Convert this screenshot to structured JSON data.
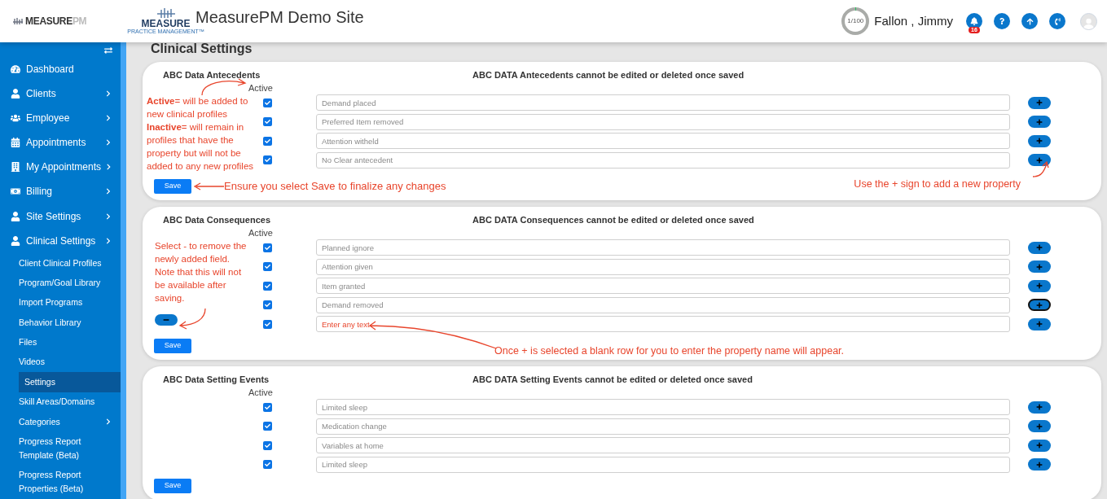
{
  "header": {
    "logo_text_a": "MEASURE",
    "logo_text_b": "PM",
    "brand_word": "MEASURE",
    "brand_tagline": "PRACTICE MANAGEMENT™",
    "site_title": "MeasurePM Demo Site",
    "progress": {
      "label": "1/100",
      "level": 0.01
    },
    "user_name": "Fallon , Jimmy",
    "notification_count": "16"
  },
  "sidebar": {
    "items": [
      {
        "label": "Dashboard",
        "kind": "gauge",
        "chevron": false
      },
      {
        "label": "Clients",
        "kind": "user",
        "chevron": true
      },
      {
        "label": "Employee",
        "kind": "users",
        "chevron": true
      },
      {
        "label": "Appointments",
        "kind": "calendar",
        "chevron": true
      },
      {
        "label": "My Appointments",
        "kind": "building",
        "chevron": true
      },
      {
        "label": "Billing",
        "kind": "money",
        "chevron": true
      },
      {
        "label": "Site Settings",
        "kind": "user",
        "chevron": true
      },
      {
        "label": "Clinical Settings",
        "kind": "user",
        "chevron": true,
        "expanded": true,
        "children": [
          {
            "label": "Client Clinical Profiles",
            "selected": false,
            "chevron": false
          },
          {
            "label": "Program/Goal Library",
            "selected": false,
            "chevron": false
          },
          {
            "label": "Import Programs",
            "selected": false,
            "chevron": false
          },
          {
            "label": "Behavior Library",
            "selected": false,
            "chevron": false
          },
          {
            "label": "Files",
            "selected": false,
            "chevron": false
          },
          {
            "label": "Videos",
            "selected": false,
            "chevron": false
          },
          {
            "label": "Settings",
            "selected": true,
            "chevron": false
          },
          {
            "label": "Skill Areas/Domains",
            "selected": false,
            "chevron": false
          },
          {
            "label": "Categories",
            "selected": false,
            "chevron": true
          },
          {
            "label": "Progress Report Template (Beta)",
            "selected": false,
            "chevron": false
          },
          {
            "label": "Progress Report Properties (Beta)",
            "selected": false,
            "chevron": false
          }
        ]
      }
    ]
  },
  "page_title": "Clinical Settings",
  "sections": [
    {
      "title": "ABC Data Antecedents",
      "notice": "ABC DATA Antecedents cannot be edited or deleted once saved",
      "active_label": "Active",
      "notes": [
        "**Active**= will be added to new clinical profiles",
        "**Inactive**= will remain in profiles that have the property but will not be added to any new profiles"
      ],
      "remove_button": false,
      "rows": [
        {
          "checked": true,
          "value": "Demand placed",
          "focused": false
        },
        {
          "checked": true,
          "value": "Preferred Item removed",
          "focused": false
        },
        {
          "checked": true,
          "value": "Attention witheld",
          "focused": false
        },
        {
          "checked": true,
          "value": "No Clear antecedent",
          "focused": false
        }
      ],
      "save_label": "Save",
      "save_note": "Ensure you select Save to finalize any changes",
      "plus_note": "Use the + sign to add a new property"
    },
    {
      "title": "ABC Data Consequences",
      "notice": "ABC DATA Consequences cannot be edited or deleted once saved",
      "active_label": "Active",
      "notes": [
        "Select - to remove the newly added field.",
        "Note that this will not be available after saving."
      ],
      "remove_button": true,
      "rows": [
        {
          "checked": true,
          "value": "Planned ignore",
          "focused": false
        },
        {
          "checked": true,
          "value": "Attention given",
          "focused": false
        },
        {
          "checked": true,
          "value": "Item granted",
          "focused": false
        },
        {
          "checked": true,
          "value": "Demand removed",
          "focused": true
        },
        {
          "checked": true,
          "placeholder": "Enter any text",
          "focused": false
        }
      ],
      "save_label": "Save",
      "row_note": "Once + is selected a blank row for you to enter the property name will appear."
    },
    {
      "title": "ABC Data Setting Events",
      "notice": "ABC DATA Setting Events cannot be edited or deleted once saved",
      "active_label": "Active",
      "remove_button": false,
      "rows": [
        {
          "checked": true,
          "value": "Limited sleep",
          "focused": false
        },
        {
          "checked": true,
          "value": "Medication change",
          "focused": false
        },
        {
          "checked": true,
          "value": "Variables at home",
          "focused": false
        },
        {
          "checked": true,
          "value": "Limited sleep",
          "focused": false
        }
      ],
      "save_label": "Save"
    }
  ]
}
